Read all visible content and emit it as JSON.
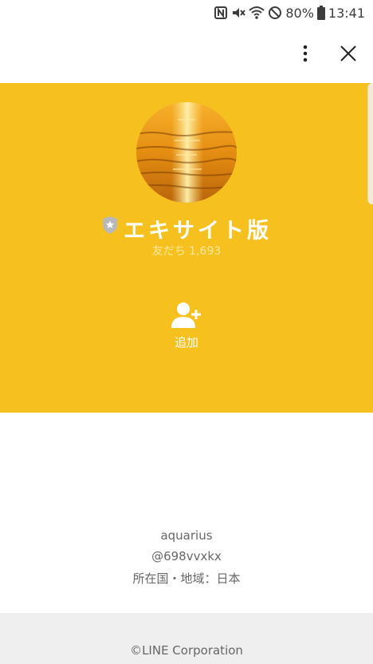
{
  "status_bar": {
    "battery_percent": "80%",
    "time": "13:41",
    "icons": [
      "nfc-icon",
      "mute-icon",
      "wifi-icon",
      "do-not-disturb-icon",
      "battery-icon"
    ]
  },
  "toolbar": {
    "menu_icon": "more-vertical-icon",
    "close_icon": "close-icon"
  },
  "profile": {
    "name": "エキサイト版",
    "friends": "友だち 1,693",
    "badge_icon": "verified-shield-icon",
    "hero_color": "#f6c11f",
    "add_label": "追加"
  },
  "details": {
    "id_name": "aquarius",
    "handle": "@698vvxkx",
    "region": "所在国・地域：日本"
  },
  "footer": {
    "copyright": "©LINE Corporation"
  }
}
